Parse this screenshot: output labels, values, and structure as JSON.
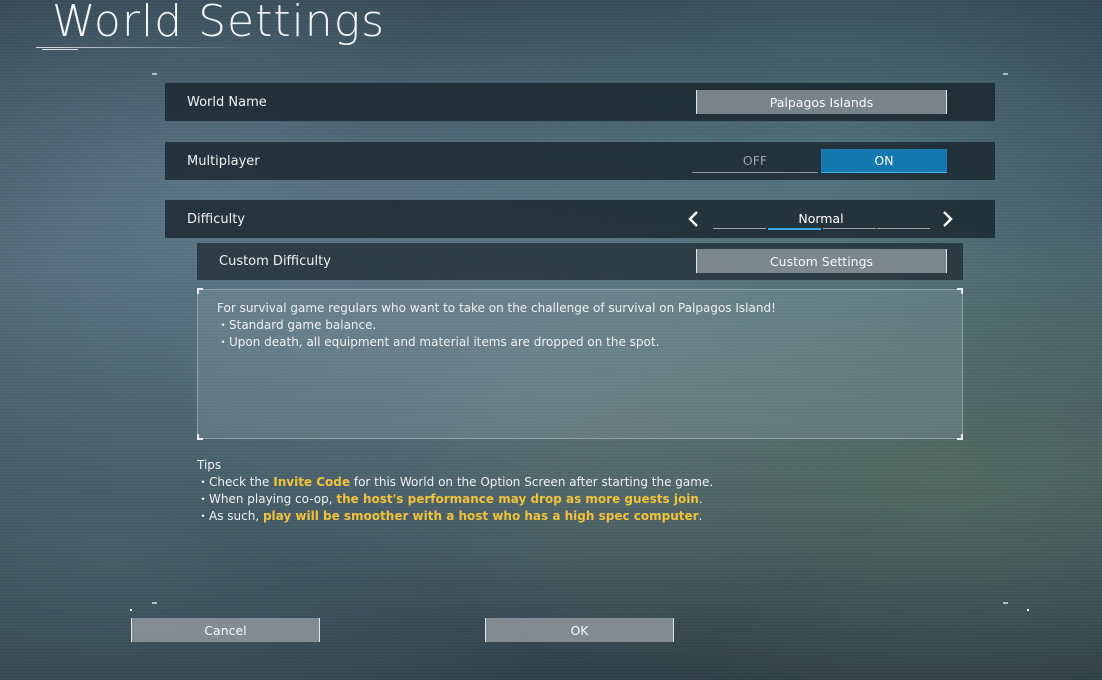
{
  "page": {
    "title": "World Settings"
  },
  "world_name": {
    "label": "World Name",
    "value": "Palpagos Islands"
  },
  "multiplayer": {
    "label": "Multiplayer",
    "off_label": "OFF",
    "on_label": "ON",
    "selected": "ON"
  },
  "difficulty": {
    "label": "Difficulty",
    "value": "Normal",
    "segment_count": 4,
    "selected_segment": 2,
    "prev_icon": "chevron-left-icon",
    "next_icon": "chevron-right-icon"
  },
  "custom_difficulty": {
    "label": "Custom Difficulty",
    "button_label": "Custom Settings"
  },
  "description": {
    "lines": [
      "For survival game regulars who want to take on the challenge of survival on Palpagos Island!",
      "・Standard game balance.",
      "・Upon death, all equipment and material items are dropped on the spot."
    ]
  },
  "tips": {
    "heading": "Tips",
    "line1": {
      "pre": "・Check the ",
      "highlight": "Invite Code",
      "post": " for this World on the Option Screen after starting the game."
    },
    "line2": {
      "pre": "・When playing co-op, ",
      "highlight": "the host's performance may drop as more guests join",
      "post": "."
    },
    "line3": {
      "pre": "・As such, ",
      "highlight": "play will be smoother with a host who has a high spec computer",
      "post": "."
    }
  },
  "buttons": {
    "cancel": "Cancel",
    "ok": "OK"
  },
  "colors": {
    "accent": "#1479ae",
    "highlight": "#f2c33a"
  }
}
